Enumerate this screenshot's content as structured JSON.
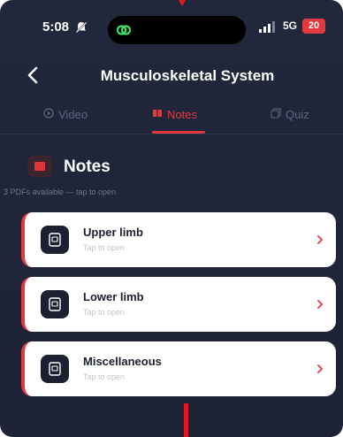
{
  "status_bar": {
    "time": "5:08",
    "network": "5G",
    "battery": "20"
  },
  "header": {
    "title": "Musculoskeletal System"
  },
  "tabs": [
    {
      "label": "Video",
      "icon": "play-circle-icon",
      "active": false
    },
    {
      "label": "Notes",
      "icon": "notes-icon",
      "active": true
    },
    {
      "label": "Quiz",
      "icon": "quiz-icon",
      "active": false
    }
  ],
  "section": {
    "title": "Notes",
    "subtitle": "3 PDFs available — tap to open"
  },
  "notes": [
    {
      "name": "Upper limb",
      "hint": "Tap to open"
    },
    {
      "name": "Lower limb",
      "hint": "Tap to open"
    },
    {
      "name": "Miscellaneous",
      "hint": "Tap to open"
    }
  ],
  "colors": {
    "background": "#1f2437",
    "accent": "#e03a40",
    "card": "#ffffff",
    "muted": "#5d6680"
  }
}
